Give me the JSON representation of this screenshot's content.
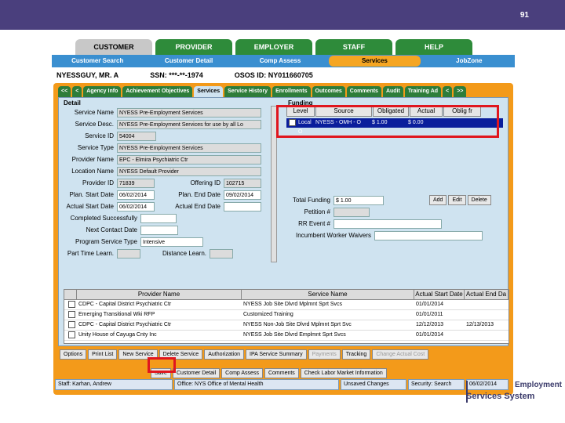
{
  "slide_number": "91",
  "main_tabs": [
    "CUSTOMER",
    "PROVIDER",
    "EMPLOYER",
    "STAFF",
    "HELP"
  ],
  "sub_nav": [
    "Customer Search",
    "Customer Detail",
    "Comp Assess",
    "Services",
    "JobZone"
  ],
  "client": {
    "name": "NYESSGUY, MR. A",
    "ssn": "SSN: ***-**-1974",
    "osos": "OSOS ID: NY011660705"
  },
  "section_tabs": [
    "<<",
    "<",
    "Agency Info",
    "Achievement Objectives",
    "Services",
    "Service History",
    "Enrollments",
    "Outcomes",
    "Comments",
    "Audit",
    "Training Ad",
    "<",
    ">>"
  ],
  "detail": {
    "legend": "Detail",
    "service_name_label": "Service Name",
    "service_name": "NYESS Pre-Employment Services",
    "service_desc_label": "Service Desc.",
    "service_desc": "NYESS Pre-Employment Services for use by all Lo",
    "service_id_label": "Service ID",
    "service_id": "54004",
    "service_type_label": "Service Type",
    "service_type": "NYESS Pre-Employment Services",
    "provider_name_label": "Provider Name",
    "provider_name": "EPC - Elmira Psychiatric Ctr",
    "location_name_label": "Location Name",
    "location_name": "NYESS Default Provider",
    "provider_id_label": "Provider ID",
    "provider_id": "71839",
    "offering_id_label": "Offering ID",
    "offering_id": "102715",
    "plan_start_label": "Plan. Start Date",
    "plan_start": "06/02/2014",
    "plan_end_label": "Plan. End Date",
    "plan_end": "09/02/2014",
    "actual_start_label": "Actual Start Date",
    "actual_start": "06/02/2014",
    "actual_end_label": "Actual End Date",
    "actual_end": "",
    "completed_label": "Completed Successfully",
    "next_contact_label": "Next Contact Date",
    "program_type_label": "Program Service Type",
    "program_type": "Intensive",
    "part_time_label": "Part Time Learn.",
    "distance_label": "Distance Learn."
  },
  "funding": {
    "legend": "Funding",
    "headers": [
      "Level",
      "Source",
      "Obligated",
      "Actual",
      "Oblig fr"
    ],
    "row": [
      "Local O",
      "NYESS - OMH - O",
      "$ 1.00",
      "$ 0.00",
      ""
    ],
    "total_label": "Total Funding",
    "total": "$ 1.00",
    "add": "Add",
    "edit": "Edit",
    "delete": "Delete",
    "petition_label": "Petition #",
    "rr_label": "RR Event #",
    "incumbent_label": "Incumbent Worker Waivers"
  },
  "grid": {
    "headers": [
      "Provider Name",
      "Service Name",
      "Actual Start Date",
      "Actual End Da"
    ],
    "rows": [
      [
        "CDPC - Capital District Psychiatric Ctr",
        "NYESS Job Site Dlvrd Mplmnt Sprt Svcs",
        "01/01/2014",
        ""
      ],
      [
        "Emerging Transitional Wki RFP",
        "Customized Training",
        "01/01/2011",
        ""
      ],
      [
        "CDPC - Capital District Psychiatric Ctr",
        "NYESS Non-Job Site Dlvrd Mplmnt Sprt Svc",
        "12/12/2013",
        "12/13/2013"
      ],
      [
        "Unity House of Cayuga Cnty Inc",
        "NYESS Job Site Dlvrd Emplmnt Sprt Svcs",
        "01/01/2014",
        ""
      ]
    ]
  },
  "buttons_row1": [
    "Options",
    "Print List",
    "New Service",
    "Delete Service",
    "Authorization",
    "IPA Service Summary",
    "Payments",
    "Tracking",
    "Change Actual Cost"
  ],
  "buttons_row2": [
    "Save",
    "Customer Detail",
    "Comp Assess",
    "Comments",
    "Check Labor Market Information"
  ],
  "status": [
    "Staff: Karhan, Andrew",
    "Office: NYS Office of Mental Health",
    "Unsaved Changes",
    "Security: Search",
    "06/02/2014"
  ],
  "logo": {
    "line1": "Employment",
    "line2": "Services System"
  },
  "colors": {
    "top_bar": "#4a3f7d",
    "green_tab": "#2e8b3a",
    "nav_blue": "#3a8fd0",
    "frame_orange": "#f39a1a",
    "panel_blue": "#cfe3f0",
    "highlight_red": "#e0161e"
  }
}
